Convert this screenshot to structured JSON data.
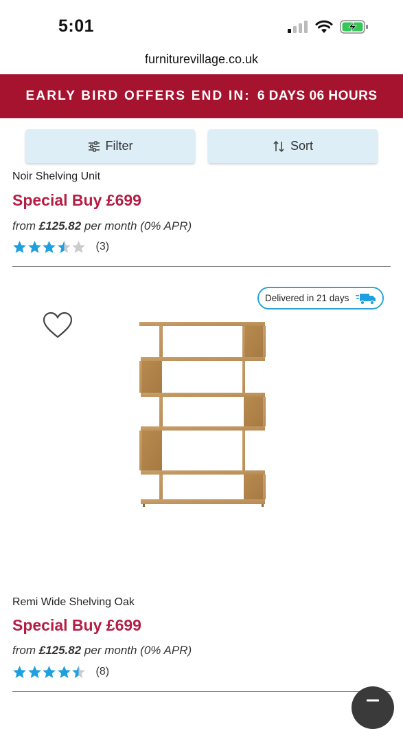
{
  "status": {
    "time": "5:01"
  },
  "browser": {
    "url": "furniturevillage.co.uk"
  },
  "promo": {
    "label": "EARLY BIRD OFFERS END IN:",
    "value": "6 DAYS 06 HOURS",
    "color": "#a6132f"
  },
  "toolbar": {
    "filter_label": "Filter",
    "sort_label": "Sort"
  },
  "products": [
    {
      "name": "Noir Shelving Unit",
      "price": "Special Buy £699",
      "finance_prefix": "from",
      "finance_amount": "£125.82",
      "finance_suffix": "per month (0% APR)",
      "rating": 3.5,
      "reviews": "(3)"
    },
    {
      "name": "Remi Wide Shelving Oak",
      "price": "Special Buy £699",
      "finance_prefix": "from",
      "finance_amount": "£125.82",
      "finance_suffix": "per month (0% APR)",
      "rating": 4.5,
      "reviews": "(8)",
      "delivery": "Delivered in 21 days"
    }
  ],
  "colors": {
    "price": "#b41e45",
    "star": "#1ea0e0",
    "star_empty": "#cccccc",
    "badge_border": "#2aa3d6"
  },
  "icons": [
    "filter-icon",
    "sort-icon",
    "heart-icon",
    "truck-icon",
    "signal-icon",
    "wifi-icon",
    "battery-icon",
    "menu-icon"
  ]
}
